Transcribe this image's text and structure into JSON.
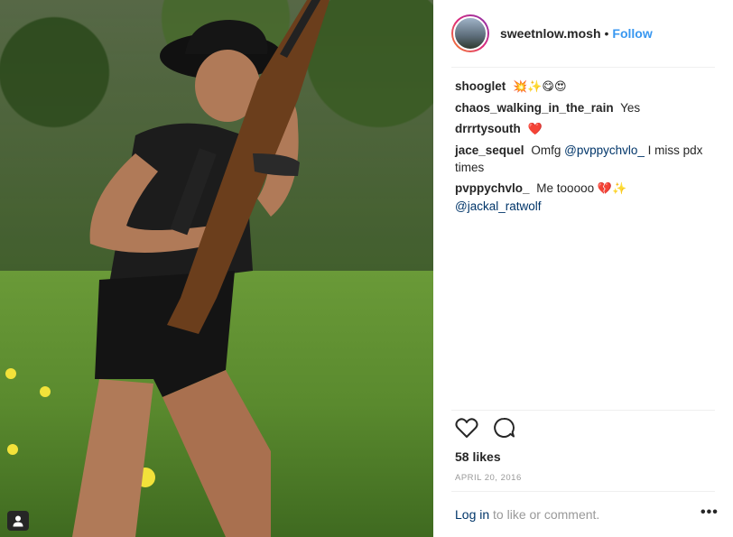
{
  "post": {
    "photo_alt_icon": "user-tag-icon"
  },
  "header": {
    "username": "sweetnlow.mosh",
    "separator": "•",
    "follow_label": "Follow"
  },
  "comments": [
    {
      "user": "shooglet",
      "text": "",
      "emoji": "💥✨😋😍"
    },
    {
      "user": "chaos_walking_in_the_rain",
      "text": "Yes",
      "emoji": ""
    },
    {
      "user": "drrrtysouth",
      "text": "",
      "emoji": "❤️"
    },
    {
      "user": "jace_sequel",
      "text_before": "Omfg",
      "mention": "@pvppychvlo_",
      "text_after": "I miss pdx times"
    },
    {
      "user": "pvppychvlo_",
      "text_before": "Me tooooo",
      "emoji": "💔✨",
      "mention": "@jackal_ratwolf"
    }
  ],
  "actions": {
    "like_icon": "heart-icon",
    "comment_icon": "comment-icon"
  },
  "likes": "58 likes",
  "date": "APRIL 20, 2016",
  "footer": {
    "login_link": "Log in",
    "login_text": "to like or comment.",
    "more_label": "•••"
  },
  "colors": {
    "link": "#3897f0",
    "mention": "#003569",
    "muted": "#999999"
  }
}
